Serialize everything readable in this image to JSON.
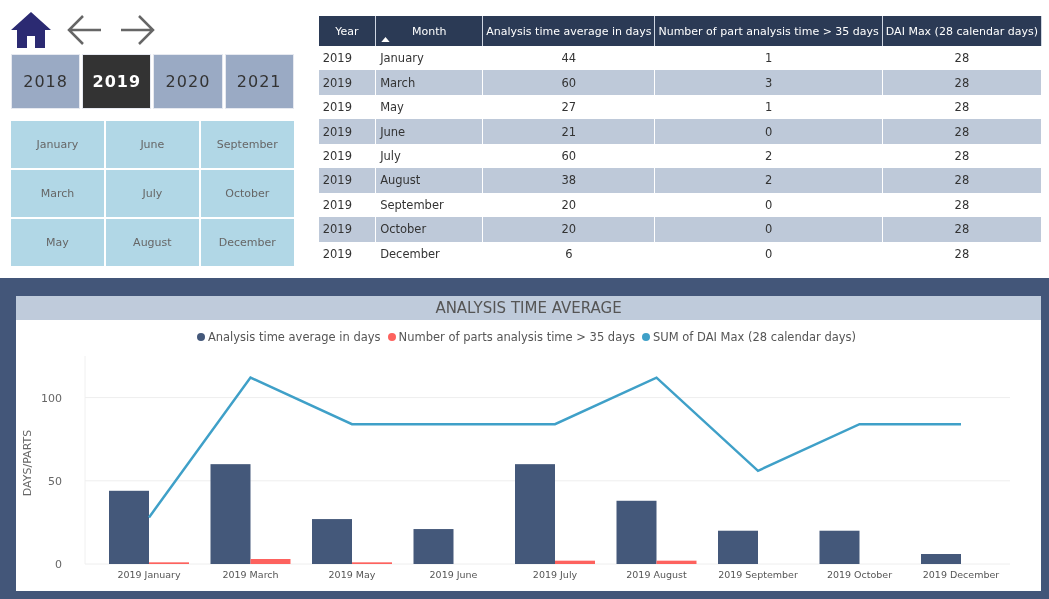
{
  "years": [
    {
      "label": "2018",
      "selected": false
    },
    {
      "label": "2019",
      "selected": true
    },
    {
      "label": "2020",
      "selected": false
    },
    {
      "label": "2021",
      "selected": false
    }
  ],
  "months": [
    "January",
    "June",
    "September",
    "March",
    "July",
    "October",
    "May",
    "August",
    "December"
  ],
  "table": {
    "columns": [
      {
        "label": "Year",
        "sorted": false
      },
      {
        "label": "Month",
        "sorted": true
      },
      {
        "label": "Analysis time average in days",
        "sorted": false
      },
      {
        "label": "Number of part analysis time > 35 days",
        "sorted": false
      },
      {
        "label": "DAI Max (28 calendar days)",
        "sorted": false
      }
    ],
    "rows": [
      [
        "2019",
        "January",
        "44",
        "1",
        "28"
      ],
      [
        "2019",
        "March",
        "60",
        "3",
        "28"
      ],
      [
        "2019",
        "May",
        "27",
        "1",
        "28"
      ],
      [
        "2019",
        "June",
        "21",
        "0",
        "28"
      ],
      [
        "2019",
        "July",
        "60",
        "2",
        "28"
      ],
      [
        "2019",
        "August",
        "38",
        "2",
        "28"
      ],
      [
        "2019",
        "September",
        "20",
        "0",
        "28"
      ],
      [
        "2019",
        "October",
        "20",
        "0",
        "28"
      ],
      [
        "2019",
        "December",
        "6",
        "0",
        "28"
      ]
    ]
  },
  "chart": {
    "chart_data": {
      "type": "bar",
      "title": "ANALYSIS TIME AVERAGE",
      "ylabel": "DAYS/PARTS",
      "categories": [
        "2019 January",
        "2019 March",
        "2019 May",
        "2019 June",
        "2019 July",
        "2019 August",
        "2019 September",
        "2019 October",
        "2019 December"
      ],
      "yticks": [
        0,
        50,
        100
      ],
      "ylim": [
        0,
        125
      ],
      "series": [
        {
          "name": "Analysis time average in days",
          "color": "#44587a",
          "type": "bar",
          "values": [
            44,
            60,
            27,
            21,
            60,
            38,
            20,
            20,
            6
          ]
        },
        {
          "name": "Number of parts analysis time > 35 days",
          "color": "#fd625e",
          "type": "bar",
          "values": [
            1,
            3,
            1,
            0,
            2,
            2,
            0,
            0,
            0
          ]
        },
        {
          "name": "SUM of DAI Max (28 calendar days)",
          "color": "#3fa0c8",
          "type": "line",
          "values": [
            28,
            112,
            84,
            84,
            84,
            112,
            56,
            84,
            84
          ]
        }
      ]
    }
  }
}
